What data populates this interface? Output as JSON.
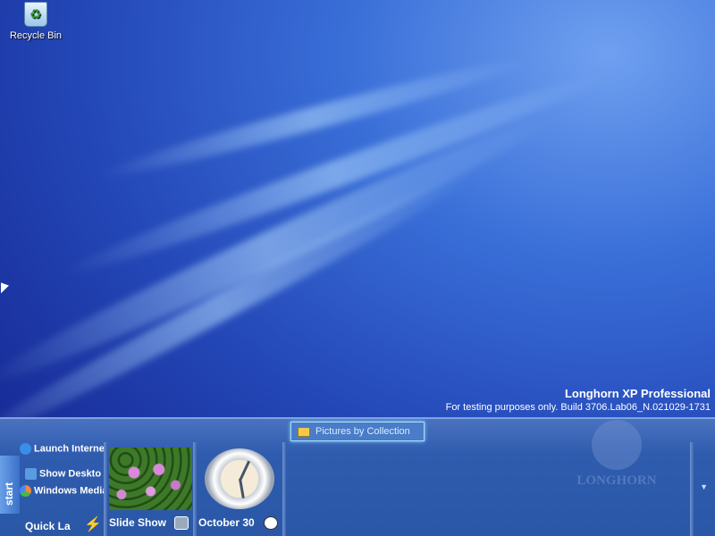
{
  "desktop": {
    "icons": [
      {
        "label": "Recycle Bin",
        "icon": "recycle-bin-icon"
      }
    ]
  },
  "branding": {
    "title": "Longhorn XP Professional",
    "subtitle": "For testing purposes only. Build 3706.Lab06_N.021029-1731",
    "watermark": "LONGHORN"
  },
  "sidebar": {
    "start_label": "start",
    "quick_launch": {
      "title": "Quick La",
      "items": [
        {
          "label": "Launch Interne",
          "icon": "internet-explorer-icon"
        },
        {
          "label": "Show Deskto",
          "icon": "show-desktop-icon"
        },
        {
          "label": "Windows Media",
          "icon": "windows-media-icon"
        }
      ]
    },
    "folder_button": "Pictures by Collection",
    "slideshow": {
      "label": "Slide Show"
    },
    "clock": {
      "label": "October 30"
    }
  }
}
